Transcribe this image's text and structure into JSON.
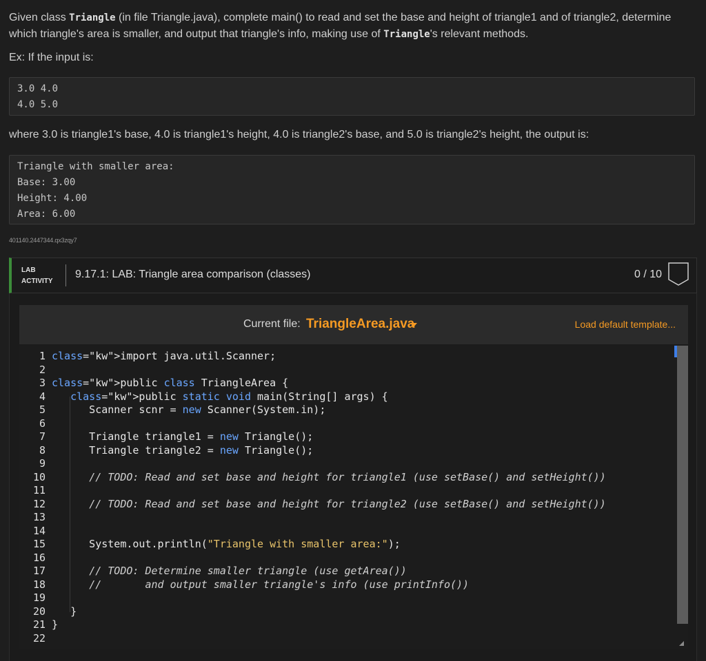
{
  "intro": {
    "p1_a": "Given class ",
    "p1_code1": "Triangle",
    "p1_b": " (in file Triangle.java), complete main() to read and set the base and height of triangle1 and of triangle2, determine which triangle's area is smaller, and output that triangle's info, making use of ",
    "p1_code2": "Triangle",
    "p1_c": "'s relevant methods.",
    "ex_label": "Ex: If the input is:",
    "input_block": "3.0 4.0\n4.0 5.0",
    "where_text": "where 3.0 is triangle1's base, 4.0 is triangle1's height, 4.0 is triangle2's base, and 5.0 is triangle2's height, the output is:",
    "output_block": "Triangle with smaller area:\nBase: 3.00\nHeight: 4.00\nArea: 6.00",
    "code_id": "401140.2447344.qx3zqy7"
  },
  "lab": {
    "tag_line1": "LAB",
    "tag_line2": "ACTIVITY",
    "title": "9.17.1: LAB: Triangle area comparison (classes)",
    "score": "0 / 10"
  },
  "file_bar": {
    "label": "Current file:",
    "file_name": "TriangleArea.java",
    "load_default": "Load default template..."
  },
  "editor": {
    "line_numbers": [
      "1",
      "2",
      "3",
      "4",
      "5",
      "6",
      "7",
      "8",
      "9",
      "10",
      "11",
      "12",
      "13",
      "14",
      "15",
      "16",
      "17",
      "18",
      "19",
      "20",
      "21",
      "22"
    ],
    "lines": [
      "import java.util.Scanner;",
      "",
      "public class TriangleArea {",
      "   public static void main(String[] args) {",
      "      Scanner scnr = new Scanner(System.in);",
      "",
      "      Triangle triangle1 = new Triangle();",
      "      Triangle triangle2 = new Triangle();",
      "",
      "      // TODO: Read and set base and height for triangle1 (use setBase() and setHeight())",
      "",
      "      // TODO: Read and set base and height for triangle2 (use setBase() and setHeight())",
      "",
      "",
      "      System.out.println(\"Triangle with smaller area:\");",
      "",
      "      // TODO: Determine smaller triangle (use getArea())",
      "      //       and output smaller triangle's info (use printInfo())",
      "",
      "   }",
      "}",
      ""
    ]
  },
  "colors": {
    "accent": "#f59a23",
    "keyword": "#6aa6ff",
    "lab_green": "#3c8c3a"
  },
  "icons": {
    "score_badge": "shield-outline-icon",
    "file_dropdown": "caret-down-icon"
  }
}
